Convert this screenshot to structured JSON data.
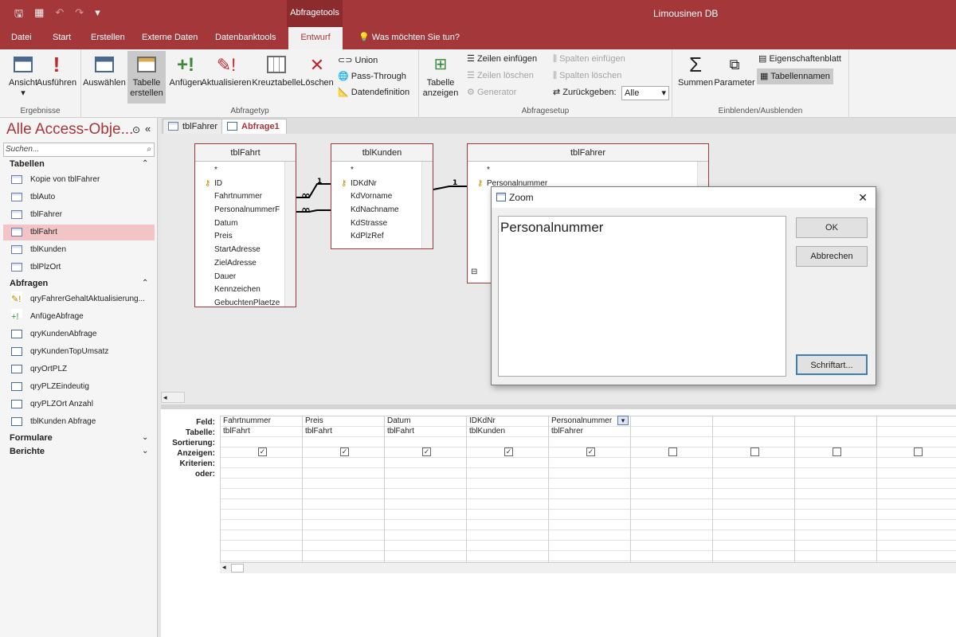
{
  "window": {
    "title": "Limousinen DB",
    "context_tab": "Abfragetools"
  },
  "ribbon_tabs": [
    {
      "label": "Datei"
    },
    {
      "label": "Start"
    },
    {
      "label": "Erstellen"
    },
    {
      "label": "Externe Daten"
    },
    {
      "label": "Datenbanktools"
    },
    {
      "label": "Entwurf"
    }
  ],
  "tell_me": "Was möchten Sie tun?",
  "ribbon": {
    "ergebnisse": {
      "label": "Ergebnisse",
      "ansicht": "Ansicht",
      "ausfuehren": "Ausführen"
    },
    "abfragetyp": {
      "label": "Abfragetyp",
      "auswaehlen": "Auswählen",
      "tabelle_erstellen": "Tabelle erstellen",
      "anfuegen": "Anfügen",
      "aktualisieren": "Aktualisieren",
      "kreuztabelle": "Kreuztabelle",
      "loeschen": "Löschen",
      "union": "Union",
      "pass_through": "Pass-Through",
      "datendefinition": "Datendefinition"
    },
    "abfragesetup": {
      "label": "Abfragesetup",
      "tabelle_anzeigen": "Tabelle anzeigen",
      "zeilen_einfuegen": "Zeilen einfügen",
      "zeilen_loeschen": "Zeilen löschen",
      "generator": "Generator",
      "spalten_einfuegen": "Spalten einfügen",
      "spalten_loeschen": "Spalten löschen",
      "zurueckgeben": "Zurückgeben:",
      "zurueckgeben_value": "Alle"
    },
    "einblenden": {
      "label": "Einblenden/Ausblenden",
      "summen": "Summen",
      "parameter": "Parameter",
      "eigenschaftenblatt": "Eigenschaftenblatt",
      "tabellennamen": "Tabellennamen"
    }
  },
  "nav": {
    "title": "Alle Access-Obje...",
    "search_placeholder": "Suchen...",
    "sections": {
      "tabellen": "Tabellen",
      "abfragen": "Abfragen",
      "formulare": "Formulare",
      "berichte": "Berichte"
    },
    "tables": [
      "Kopie von tblFahrer",
      "tblAuto",
      "tblFahrer",
      "tblFahrt",
      "tblKunden",
      "tblPlzOrt"
    ],
    "queries": [
      "qryFahrerGehaltAktualisierung...",
      "AnfügeAbfrage",
      "qryKundenAbfrage",
      "qryKundenTopUmsatz",
      "qryOrtPLZ",
      "qryPLZEindeutig",
      "qryPLZOrt Anzahl",
      "tblKunden Abfrage"
    ]
  },
  "doc_tabs": [
    "tblFahrer",
    "Abfrage1"
  ],
  "tables": {
    "fahrt": {
      "name": "tblFahrt",
      "fields": [
        "*",
        "ID",
        "Fahrtnummer",
        "PersonalnummerF",
        "Datum",
        "Preis",
        "StartAdresse",
        "ZielAdresse",
        "Dauer",
        "Kennzeichen",
        "GebuchtenPlaetze"
      ]
    },
    "kunden": {
      "name": "tblKunden",
      "fields": [
        "*",
        "IDKdNr",
        "KdVorname",
        "KdNachname",
        "KdStrasse",
        "KdPlzRef"
      ]
    },
    "fahrer": {
      "name": "tblFahrer",
      "fields": [
        "*",
        "Personalnummer"
      ]
    }
  },
  "relation_labels": {
    "one": "1",
    "many": "∞"
  },
  "grid": {
    "row_labels": [
      "Feld:",
      "Tabelle:",
      "Sortierung:",
      "Anzeigen:",
      "Kriterien:",
      "oder:"
    ],
    "columns": [
      {
        "field": "Fahrtnummer",
        "table": "tblFahrt",
        "show": "true"
      },
      {
        "field": "Preis",
        "table": "tblFahrt",
        "show": "true"
      },
      {
        "field": "Datum",
        "table": "tblFahrt",
        "show": "true"
      },
      {
        "field": "IDKdNr",
        "table": "tblKunden",
        "show": "true"
      },
      {
        "field": "Personalnummer",
        "table": "tblFahrer",
        "show": "true"
      },
      {
        "field": "",
        "table": "",
        "show": "false"
      },
      {
        "field": "",
        "table": "",
        "show": "false"
      },
      {
        "field": "",
        "table": "",
        "show": "false"
      },
      {
        "field": "",
        "table": "",
        "show": "false"
      }
    ]
  },
  "zoom_dialog": {
    "title": "Zoom",
    "text": "Personalnummer",
    "ok": "OK",
    "abbrechen": "Abbrechen",
    "schriftart": "Schriftart..."
  },
  "colors": {
    "accent": "#a4373a"
  }
}
